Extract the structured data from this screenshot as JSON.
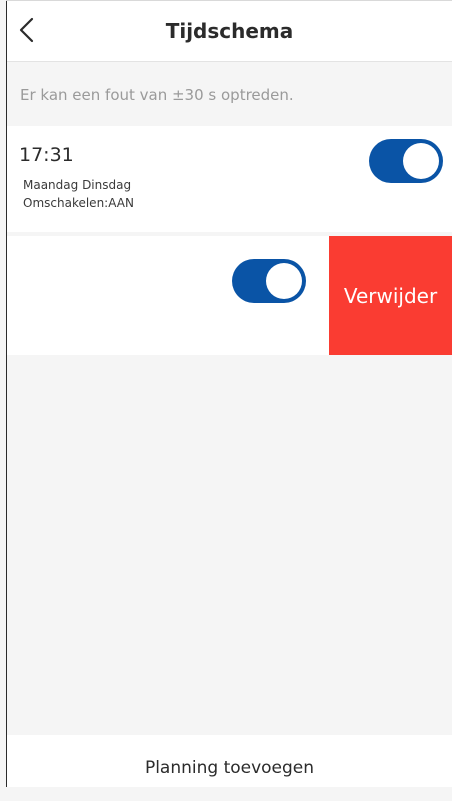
{
  "header": {
    "title": "Tijdschema",
    "back_icon": "chevron-left-icon"
  },
  "info_text": "Er kan een fout van ±30 s optreden.",
  "schedules": [
    {
      "time": "17:31",
      "days": "Maandag Dinsdag",
      "action": "Omschakelen:AAN",
      "enabled": true
    },
    {
      "time": "",
      "days": "",
      "action": "",
      "enabled": true,
      "delete_label": "Verwijder"
    }
  ],
  "footer": {
    "add_label": "Planning toevoegen"
  },
  "colors": {
    "toggle_on": "#0a54a6",
    "delete": "#fa3c32",
    "background": "#f5f5f5"
  }
}
